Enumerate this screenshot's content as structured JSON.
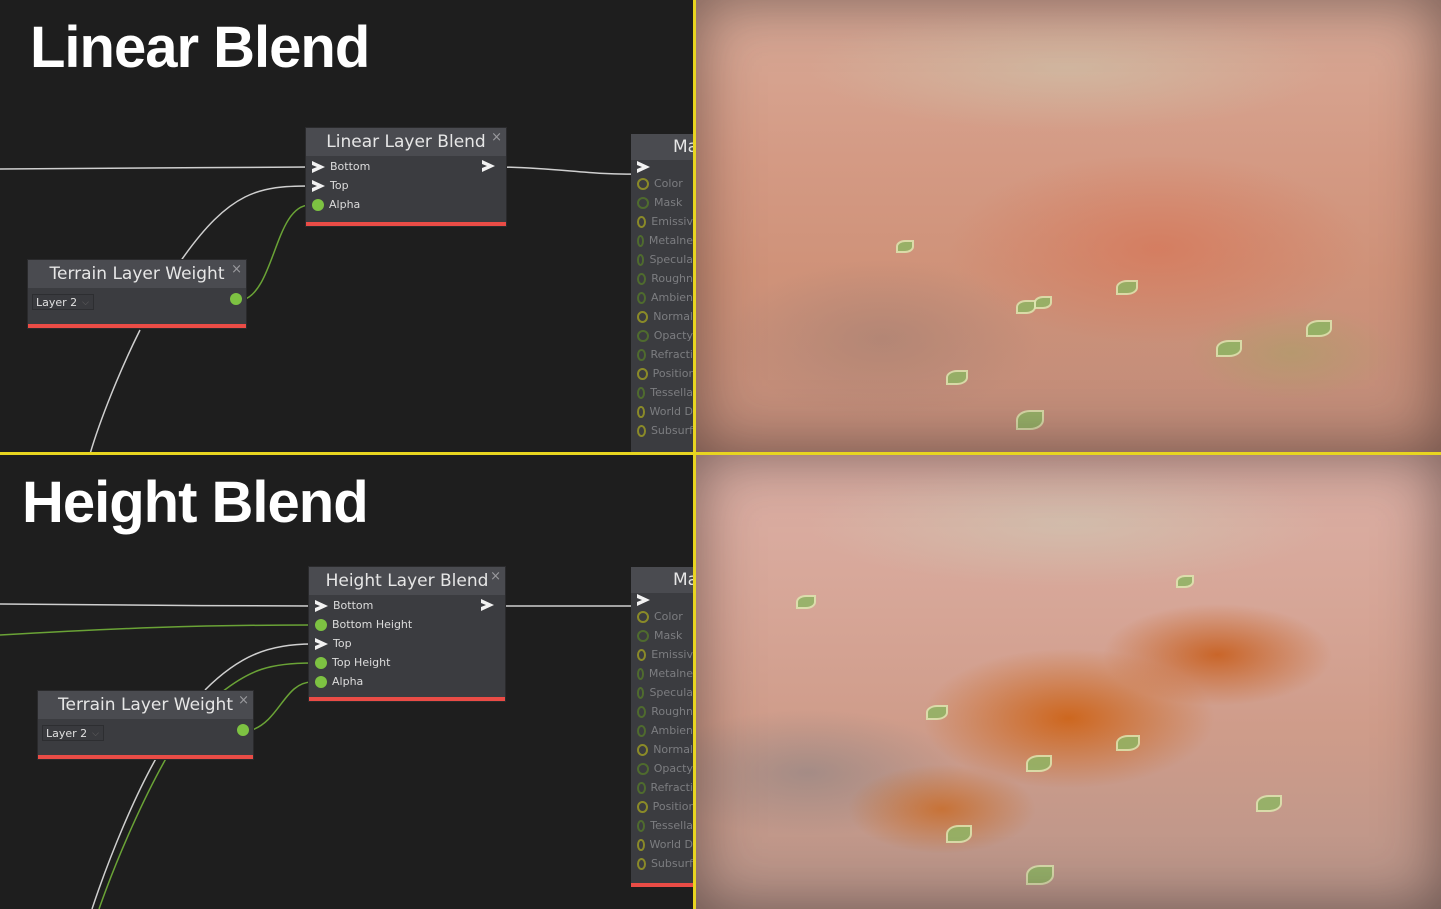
{
  "panels": [
    {
      "heading": "Linear Blend",
      "blend_node": {
        "title": "Linear Layer Blend",
        "inputs": [
          {
            "label": "Bottom",
            "type": "arrow"
          },
          {
            "label": "Top",
            "type": "arrow"
          },
          {
            "label": "Alpha",
            "type": "dot"
          }
        ]
      },
      "weight_node": {
        "title": "Terrain Layer Weight",
        "layer_select": "Layer 2"
      },
      "render_description": "Terrain render: sand and reddish soil with a soft linear transition and small green plants"
    },
    {
      "heading": "Height Blend",
      "blend_node": {
        "title": "Height Layer Blend",
        "inputs": [
          {
            "label": "Bottom",
            "type": "arrow"
          },
          {
            "label": "Bottom Height",
            "type": "dot"
          },
          {
            "label": "Top",
            "type": "arrow"
          },
          {
            "label": "Top Height",
            "type": "dot"
          },
          {
            "label": "Alpha",
            "type": "dot"
          }
        ]
      },
      "weight_node": {
        "title": "Terrain Layer Weight",
        "layer_select": "Layer 2"
      },
      "render_description": "Terrain render: sand with orange mud filling crevices via height-based blending and green plants"
    }
  ],
  "master_node": {
    "title": "Ma",
    "inputs": [
      {
        "label": "Color",
        "ring": "yellow"
      },
      {
        "label": "Mask",
        "ring": "green"
      },
      {
        "label": "Emissiv",
        "ring": "yellow"
      },
      {
        "label": "Metalne",
        "ring": "green"
      },
      {
        "label": "Specula",
        "ring": "green"
      },
      {
        "label": "Roughn",
        "ring": "green"
      },
      {
        "label": "Ambien",
        "ring": "green"
      },
      {
        "label": "Normal",
        "ring": "yellow"
      },
      {
        "label": "Opacty",
        "ring": "green"
      },
      {
        "label": "Refracti",
        "ring": "green"
      },
      {
        "label": "Positior",
        "ring": "yellow"
      },
      {
        "label": "Tessella",
        "ring": "green"
      },
      {
        "label": "World D",
        "ring": "yellow"
      },
      {
        "label": "Subsurf",
        "ring": "yellow"
      }
    ]
  },
  "icons": {
    "close": "×",
    "chevron": "⌵"
  },
  "colors": {
    "node_bar": "#ea4c46",
    "bool_pin": "#7dc242",
    "divider": "#e8d520"
  }
}
